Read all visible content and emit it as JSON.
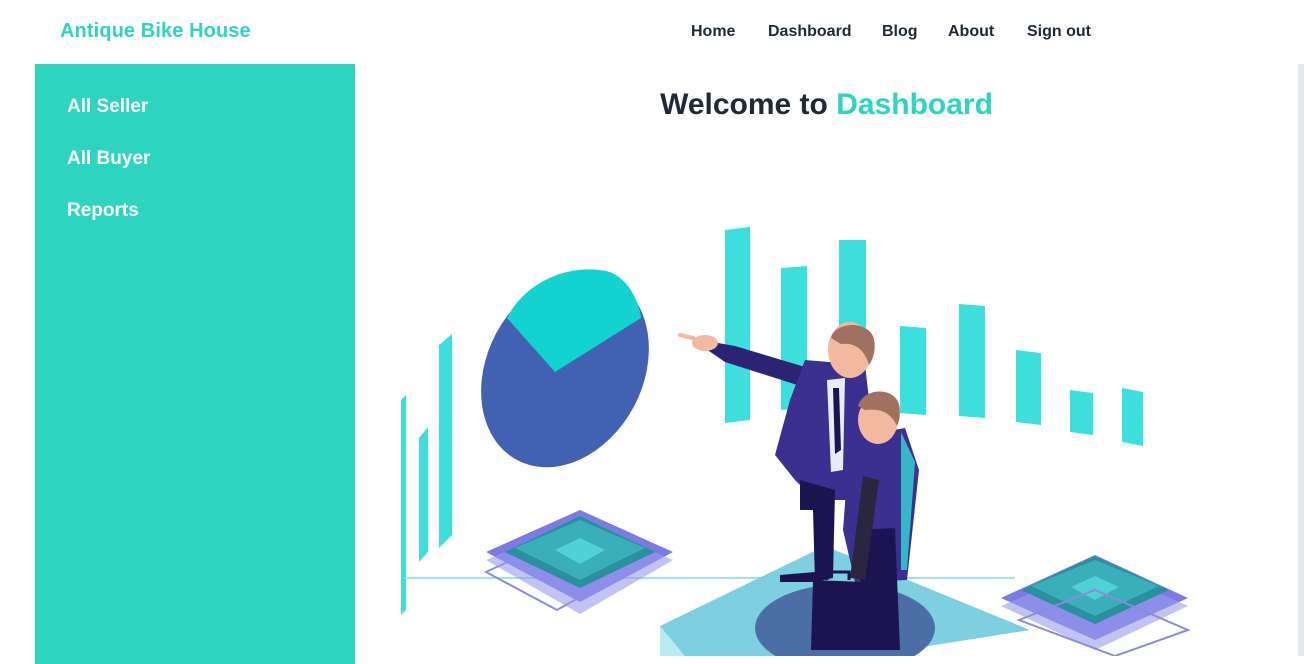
{
  "brand": "Antique Bike House",
  "nav": {
    "home": "Home",
    "dashboard": "Dashboard",
    "blog": "Blog",
    "about": "About",
    "signout": "Sign out"
  },
  "sidebar": {
    "items": [
      {
        "label": "All Seller"
      },
      {
        "label": "All Buyer"
      },
      {
        "label": "Reports"
      }
    ]
  },
  "main": {
    "welcome_prefix": "Welcome to",
    "welcome_accent": "Dashboard"
  },
  "colors": {
    "accent": "#2dd4bf",
    "text_dark": "#1f2937",
    "bars": "#3ddfdc",
    "pie_blue": "#4361b3",
    "pie_teal": "#12d3cf",
    "suit": "#3b2f8f"
  },
  "illustration": {
    "name": "business-analytics-illustration"
  }
}
